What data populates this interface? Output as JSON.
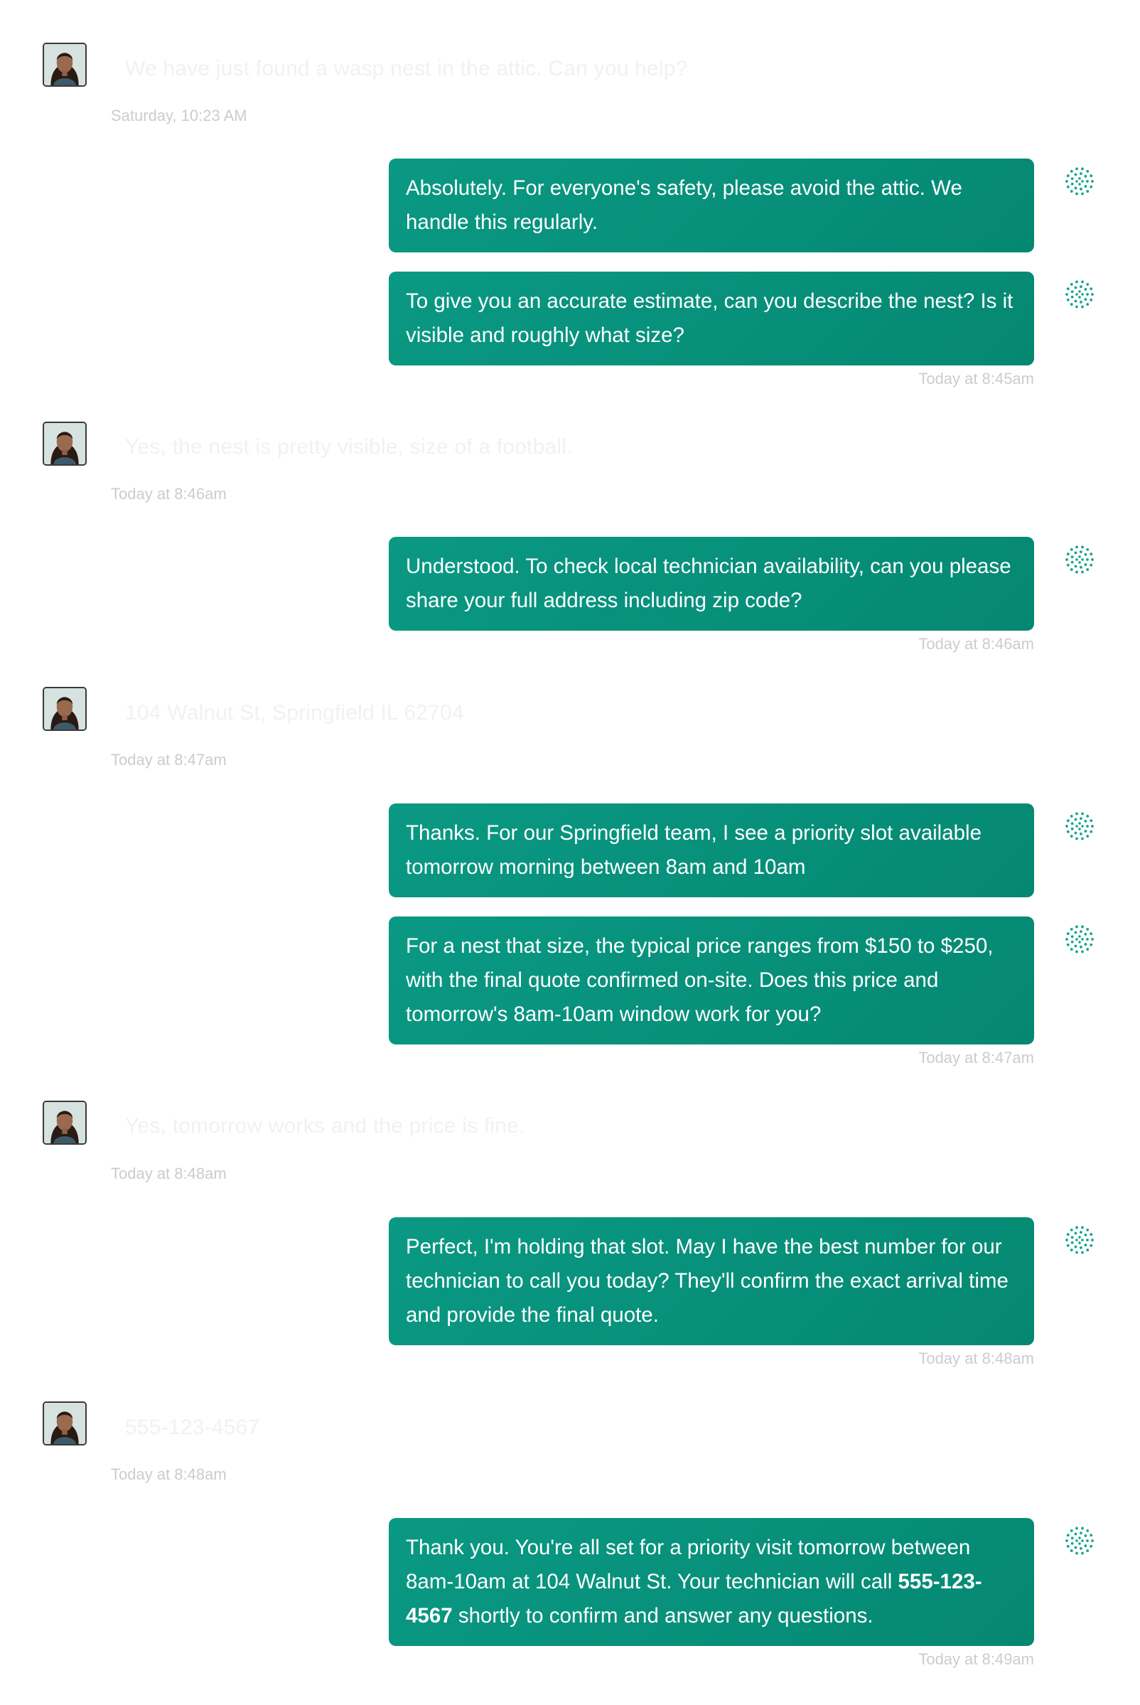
{
  "conversation": {
    "messages": [
      {
        "sender": "user",
        "text": "We have just found a wasp nest in the attic. Can you help?",
        "timestamp": "Saturday, 10:23 AM"
      },
      {
        "sender": "bot",
        "text": "Absolutely. For everyone's safety, please avoid the attic. We handle this regularly."
      },
      {
        "sender": "bot",
        "text": "To give you an accurate estimate, can you describe the nest? Is it visible and roughly what size?",
        "timestamp": "Today at 8:45am"
      },
      {
        "sender": "user",
        "text": "Yes, the nest is pretty visible, size of a football.",
        "timestamp": "Today at 8:46am"
      },
      {
        "sender": "bot",
        "text": "Understood. To check local technician availability, can you please share your full address including zip code?",
        "timestamp": "Today at 8:46am"
      },
      {
        "sender": "user",
        "text": "104 Walnut St, Springfield IL 62704",
        "timestamp": "Today at 8:47am"
      },
      {
        "sender": "bot",
        "text": "Thanks. For our Springfield team, I see a priority slot available tomorrow morning between 8am and 10am"
      },
      {
        "sender": "bot",
        "text": "For a nest that size, the typical price ranges from $150 to $250, with the final quote confirmed on-site. Does this price and tomorrow's 8am-10am window work for you?",
        "timestamp": "Today at 8:47am"
      },
      {
        "sender": "user",
        "text": "Yes, tomorrow works and the price is fine.",
        "timestamp": "Today at 8:48am"
      },
      {
        "sender": "bot",
        "text": "Perfect, I'm holding that slot. May I have the best number for our technician to call you today? They'll confirm the exact arrival time and provide the final quote.",
        "timestamp": "Today at 8:48am"
      },
      {
        "sender": "user",
        "text": "555-123-4567",
        "timestamp": "Today at 8:48am"
      },
      {
        "sender": "bot",
        "text_before": "Thank you. You're all set for a priority visit tomorrow between 8am-10am at 104 Walnut St. Your technician will call ",
        "text_bold": "555-123-4567",
        "text_after": " shortly to confirm and answer any questions.",
        "timestamp": "Today at 8:49am"
      }
    ]
  },
  "icons": {
    "user_avatar": "user-avatar-photo",
    "bot": "dotted-circle-bot-icon"
  },
  "colors": {
    "bubble": "#0a9984",
    "bubble_dark": "#058872",
    "timestamp": "#c9cdd0",
    "bot_icon": "#15a58b"
  }
}
